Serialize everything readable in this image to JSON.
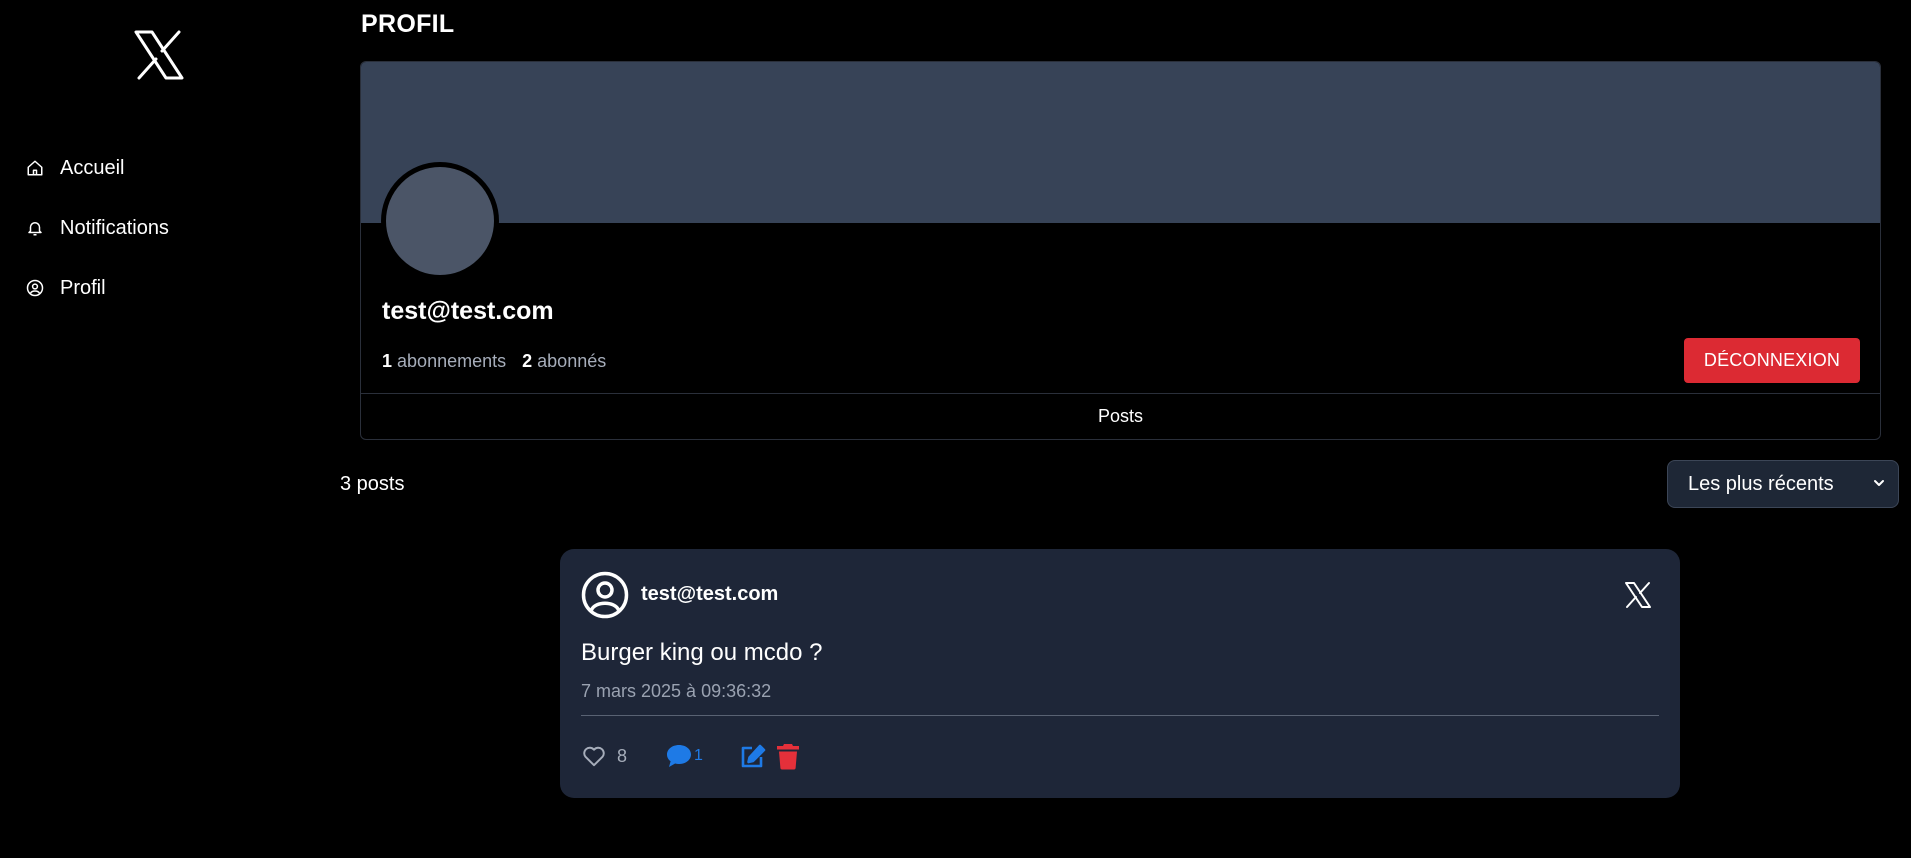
{
  "page": {
    "title": "PROFIL"
  },
  "sidebar": {
    "logo_icon": "x-logo-icon",
    "items": [
      {
        "label": "Accueil",
        "icon": "home-icon"
      },
      {
        "label": "Notifications",
        "icon": "bell-icon"
      },
      {
        "label": "Profil",
        "icon": "user-circle-icon"
      }
    ]
  },
  "profile": {
    "name": "test@test.com",
    "following_count": "1",
    "following_label": "abonnements",
    "followers_count": "2",
    "followers_label": "abonnés",
    "logout_label": "DÉCONNEXION",
    "tab_label": "Posts"
  },
  "posts_header": {
    "count_label": "3 posts",
    "sort_selected": "Les plus récents"
  },
  "post": {
    "author": "test@test.com",
    "text": "Burger king ou mcdo ?",
    "date": "7 mars 2025 à 09:36:32",
    "likes": "8",
    "comments": "1"
  },
  "colors": {
    "banner": "#374357",
    "avatar": "#4b5567",
    "danger": "#dc2a33",
    "card": "#1e2638",
    "accent": "#1e7ae6"
  }
}
